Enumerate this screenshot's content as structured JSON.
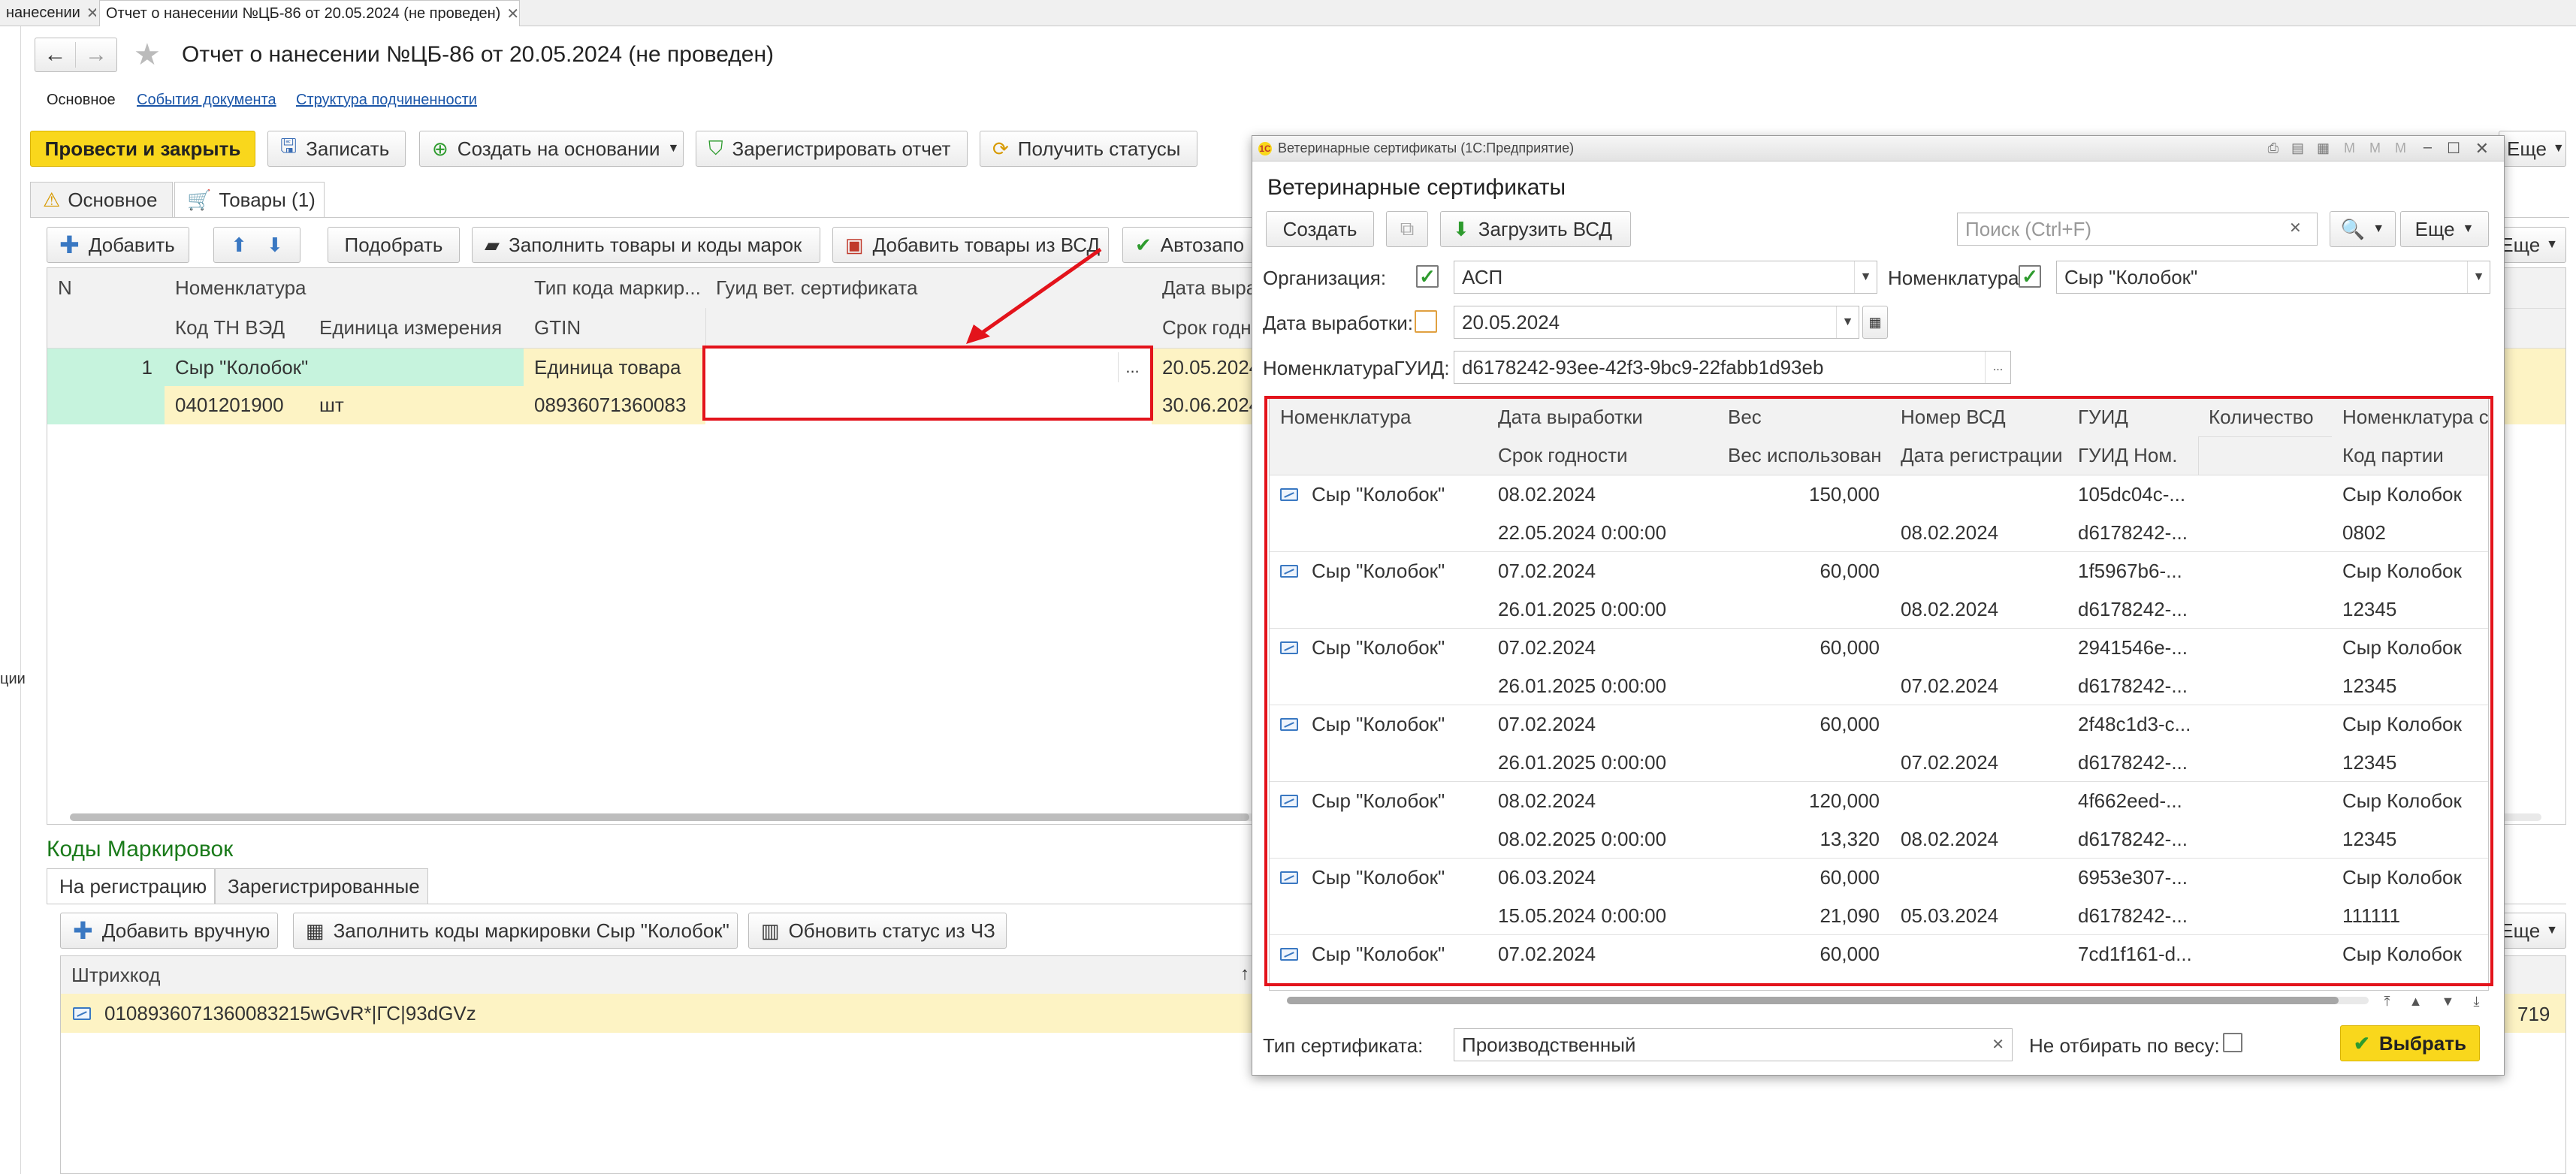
{
  "tabs": {
    "prev_label": "нанесении",
    "active_label": "Отчет о нанесении №ЦБ-86 от 20.05.2024 (не проведен)"
  },
  "left_strip_text": "ции",
  "doc": {
    "title": "Отчет о нанесении №ЦБ-86 от 20.05.2024 (не проведен)",
    "nav": {
      "main": "Основное",
      "events": "События документа",
      "structure": "Структура подчиненности"
    },
    "toolbar": {
      "post_close": "Провести и закрыть",
      "save": "Записать",
      "create_based": "Создать на основании",
      "register": "Зарегистрировать отчет",
      "get_statuses": "Получить статусы",
      "more": "Еще"
    },
    "tabs": {
      "main": "Основное",
      "goods": "Товары (1)"
    },
    "goods_toolbar": {
      "add": "Добавить",
      "pick": "Подобрать",
      "fill_goods_codes": "Заполнить товары и коды марок",
      "add_from_vsd": "Добавить товары из ВСД",
      "autofill": "Автозапо",
      "more": "Еще"
    },
    "goods_grid": {
      "headers_row1": [
        "N",
        "Номенклатура",
        "Тип кода маркир...",
        "Гуид вет. сертификата",
        "Дата выраб"
      ],
      "headers_row2": [
        "Код ТН ВЭД",
        "Единица измерения",
        "GTIN",
        "Срок годнос"
      ],
      "row": {
        "n": "1",
        "nomenclature": "Сыр \"Колобок\"",
        "code_type": "Единица товара",
        "guid": "",
        "date": "20.05.2024",
        "tn_ved": "0401201900",
        "unit": "шт",
        "gtin": "08936071360083",
        "expiry": "30.06.2024",
        "ellipsis": "..."
      }
    },
    "codes": {
      "title": "Коды Маркировок",
      "tabs": {
        "registration": "На регистрацию",
        "registered": "Зарегистрированные"
      },
      "toolbar": {
        "add_manual": "Добавить вручную",
        "fill_codes": "Заполнить коды маркировки Сыр \"Колобок\"",
        "update_status": "Обновить статус из ЧЗ",
        "more": "Еще"
      },
      "grid": {
        "header": "Штрихкод",
        "sort": "↑",
        "row_code": "0108936071360083215wGvR*|ГС|93dGVz",
        "row_tail": "719"
      }
    }
  },
  "dialog": {
    "window_title": "Ветеринарные сертификаты (1С:Предприятие)",
    "title": "Ветеринарные сертификаты",
    "toolbar": {
      "create": "Создать",
      "load_vsd": "Загрузить ВСД",
      "search_placeholder": "Поиск (Ctrl+F)",
      "more": "Еще"
    },
    "filters": {
      "org_label": "Организация:",
      "org_value": "АСП",
      "nom_label": "Номенклатура:",
      "nom_value": "Сыр \"Колобок\"",
      "date_label": "Дата выработки:",
      "date_value": "20.05.2024",
      "guid_label": "НоменклатураГУИД:",
      "guid_value": "d6178242-93ee-42f3-9bc9-22fabb1d93eb",
      "ellipsis": "..."
    },
    "grid": {
      "headers_row1": [
        "Номенклатура",
        "Дата выработки",
        "Вес",
        "Номер ВСД",
        "ГУИД",
        "Количество",
        "Номенклатура с"
      ],
      "headers_row2": [
        "Срок годности",
        "Вес использован",
        "Дата регистрации",
        "ГУИД Ном.",
        "Код партии"
      ],
      "rows": [
        {
          "nom": "Сыр \"Колобок\"",
          "prod": "08.02.2024",
          "weight": "150,000",
          "vsd": "",
          "guid": "105dc04c-...",
          "qty": "",
          "nom2": "Сыр Колобок",
          "exp": "22.05.2024 0:00:00",
          "used": "",
          "reg": "08.02.2024",
          "guid_nom": "d6178242-...",
          "batch": "0802"
        },
        {
          "nom": "Сыр \"Колобок\"",
          "prod": "07.02.2024",
          "weight": "60,000",
          "vsd": "",
          "guid": "1f5967b6-...",
          "qty": "",
          "nom2": "Сыр Колобок",
          "exp": "26.01.2025 0:00:00",
          "used": "",
          "reg": "08.02.2024",
          "guid_nom": "d6178242-...",
          "batch": "12345"
        },
        {
          "nom": "Сыр \"Колобок\"",
          "prod": "07.02.2024",
          "weight": "60,000",
          "vsd": "",
          "guid": "2941546e-...",
          "qty": "",
          "nom2": "Сыр Колобок",
          "exp": "26.01.2025 0:00:00",
          "used": "",
          "reg": "07.02.2024",
          "guid_nom": "d6178242-...",
          "batch": "12345"
        },
        {
          "nom": "Сыр \"Колобок\"",
          "prod": "07.02.2024",
          "weight": "60,000",
          "vsd": "",
          "guid": "2f48c1d3-c...",
          "qty": "",
          "nom2": "Сыр Колобок",
          "exp": "26.01.2025 0:00:00",
          "used": "",
          "reg": "07.02.2024",
          "guid_nom": "d6178242-...",
          "batch": "12345"
        },
        {
          "nom": "Сыр \"Колобок\"",
          "prod": "08.02.2024",
          "weight": "120,000",
          "vsd": "",
          "guid": "4f662eed-...",
          "qty": "",
          "nom2": "Сыр Колобок",
          "exp": "08.02.2025 0:00:00",
          "used": "13,320",
          "reg": "08.02.2024",
          "guid_nom": "d6178242-...",
          "batch": "12345"
        },
        {
          "nom": "Сыр \"Колобок\"",
          "prod": "06.03.2024",
          "weight": "60,000",
          "vsd": "",
          "guid": "6953e307-...",
          "qty": "",
          "nom2": "Сыр Колобок",
          "exp": "15.05.2024 0:00:00",
          "used": "21,090",
          "reg": "05.03.2024",
          "guid_nom": "d6178242-...",
          "batch": "111111"
        },
        {
          "nom": "Сыр \"Колобок\"",
          "prod": "07.02.2024",
          "weight": "60,000",
          "vsd": "",
          "guid": "7cd1f161-d...",
          "qty": "",
          "nom2": "Сыр Колобок",
          "exp": "",
          "used": "",
          "reg": "",
          "guid_nom": "",
          "batch": ""
        }
      ]
    },
    "bottom": {
      "cert_type_label": "Тип сертификата:",
      "cert_type_value": "Производственный",
      "no_weight_label": "Не отбирать по весу:",
      "select": "Выбрать"
    }
  },
  "colors": {
    "accent_yellow": "#f9d71c",
    "highlight_red": "#e3131b",
    "row_green": "#c6f3dd",
    "row_yellow": "#fdf3c4",
    "link_blue": "#1a55a8"
  }
}
